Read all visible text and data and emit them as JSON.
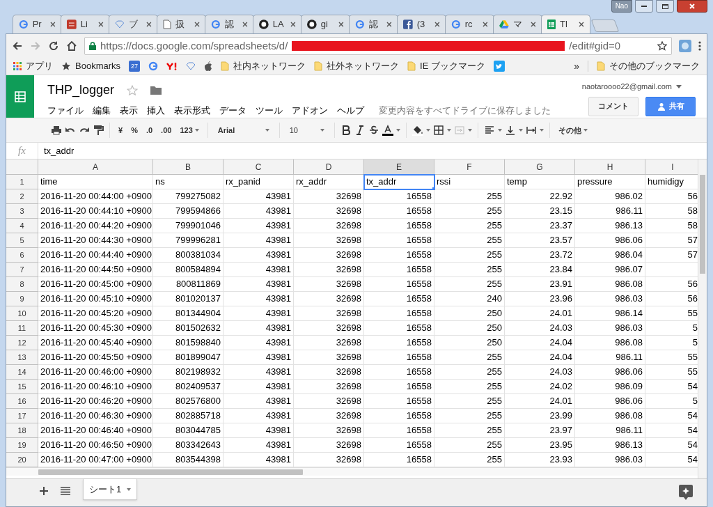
{
  "browser": {
    "profile": "Nao",
    "tabs": [
      {
        "label": "Pr",
        "kind": "google",
        "selected": false
      },
      {
        "label": "Li",
        "kind": "red",
        "selected": false
      },
      {
        "label": "ブ",
        "kind": "diamond",
        "selected": false
      },
      {
        "label": "扱",
        "kind": "page",
        "selected": false
      },
      {
        "label": "認",
        "kind": "google",
        "selected": false
      },
      {
        "label": "LA",
        "kind": "github",
        "selected": false
      },
      {
        "label": "gi",
        "kind": "github",
        "selected": false
      },
      {
        "label": "認",
        "kind": "google",
        "selected": false
      },
      {
        "label": "(3",
        "kind": "facebook",
        "selected": false
      },
      {
        "label": "rc",
        "kind": "google",
        "selected": false
      },
      {
        "label": "マ",
        "kind": "drive",
        "selected": false
      },
      {
        "label": "Tl",
        "kind": "sheets",
        "selected": true
      }
    ],
    "address": {
      "url_start": "https://docs.google.com/spreadsheets/d/",
      "url_end": "/edit#gid=0"
    },
    "bookmarks": [
      {
        "kind": "apps",
        "label": "アプリ"
      },
      {
        "kind": "star",
        "label": "Bookmarks"
      },
      {
        "kind": "calendar",
        "label": "27"
      },
      {
        "kind": "google"
      },
      {
        "kind": "yahoo"
      },
      {
        "kind": "diamond"
      },
      {
        "kind": "apple"
      },
      {
        "kind": "folder",
        "label": "社内ネットワーク"
      },
      {
        "kind": "folder",
        "label": "社外ネットワーク"
      },
      {
        "kind": "folder",
        "label": "IE ブックマーク"
      },
      {
        "kind": "twitter"
      }
    ],
    "more": "»",
    "other_bookmarks": "その他のブックマーク"
  },
  "sheets": {
    "title": "THP_logger",
    "account": "naotaroooo22@gmail.com",
    "menus": [
      "ファイル",
      "編集",
      "表示",
      "挿入",
      "表示形式",
      "データ",
      "ツール",
      "アドオン",
      "ヘルプ"
    ],
    "save_status": "変更内容をすべてドライブに保存しました",
    "comment_button": "コメント",
    "share_button": "共有",
    "toolbar": {
      "currency": "¥",
      "percent": "%",
      "decimal_less": ".0",
      "decimal_more": ".00",
      "format": "123",
      "font": "Arial",
      "size": "10",
      "more": "その他"
    },
    "formula_bar": {
      "label": "fx",
      "value": "tx_addr"
    },
    "columns": [
      {
        "label": "A",
        "kind": "text",
        "selected": false
      },
      {
        "label": "B",
        "kind": "number",
        "selected": false
      },
      {
        "label": "C",
        "kind": "number",
        "selected": false
      },
      {
        "label": "D",
        "kind": "number",
        "selected": false
      },
      {
        "label": "E",
        "kind": "number",
        "selected": true
      },
      {
        "label": "F",
        "kind": "number",
        "selected": false
      },
      {
        "label": "G",
        "kind": "number",
        "selected": false
      },
      {
        "label": "H",
        "kind": "number",
        "selected": false
      },
      {
        "label": "I",
        "kind": "number",
        "selected": false
      }
    ],
    "rows": [
      {
        "number": "1",
        "kind": "header",
        "active": true,
        "cells": [
          "time",
          "ns",
          "rx_panid",
          "rx_addr",
          "tx_addr",
          "rssi",
          "temp",
          "pressure",
          "humidigy"
        ]
      },
      {
        "number": "2",
        "kind": "data",
        "active": false,
        "cells": [
          "2016-11-20 00:44:00 +0900",
          "799275082",
          "43981",
          "32698",
          "16558",
          "255",
          "22.92",
          "986.02",
          "56"
        ]
      },
      {
        "number": "3",
        "kind": "data",
        "active": false,
        "cells": [
          "2016-11-20 00:44:10 +0900",
          "799594866",
          "43981",
          "32698",
          "16558",
          "255",
          "23.15",
          "986.11",
          "58"
        ]
      },
      {
        "number": "4",
        "kind": "data",
        "active": false,
        "cells": [
          "2016-11-20 00:44:20 +0900",
          "799901046",
          "43981",
          "32698",
          "16558",
          "255",
          "23.37",
          "986.13",
          "58"
        ]
      },
      {
        "number": "5",
        "kind": "data",
        "active": false,
        "cells": [
          "2016-11-20 00:44:30 +0900",
          "799996281",
          "43981",
          "32698",
          "16558",
          "255",
          "23.57",
          "986.06",
          "57"
        ]
      },
      {
        "number": "6",
        "kind": "data",
        "active": false,
        "cells": [
          "2016-11-20 00:44:40 +0900",
          "800381034",
          "43981",
          "32698",
          "16558",
          "255",
          "23.72",
          "986.04",
          "57"
        ]
      },
      {
        "number": "7",
        "kind": "data",
        "active": false,
        "cells": [
          "2016-11-20 00:44:50 +0900",
          "800584894",
          "43981",
          "32698",
          "16558",
          "255",
          "23.84",
          "986.07",
          null
        ]
      },
      {
        "number": "8",
        "kind": "data",
        "active": false,
        "cells": [
          "2016-11-20 00:45:00 +0900",
          "800811869",
          "43981",
          "32698",
          "16558",
          "255",
          "23.91",
          "986.08",
          "56"
        ]
      },
      {
        "number": "9",
        "kind": "data",
        "active": false,
        "cells": [
          "2016-11-20 00:45:10 +0900",
          "801020137",
          "43981",
          "32698",
          "16558",
          "240",
          "23.96",
          "986.03",
          "56"
        ]
      },
      {
        "number": "10",
        "kind": "data",
        "active": false,
        "cells": [
          "2016-11-20 00:45:20 +0900",
          "801344904",
          "43981",
          "32698",
          "16558",
          "250",
          "24.01",
          "986.14",
          "55"
        ]
      },
      {
        "number": "11",
        "kind": "data",
        "active": false,
        "cells": [
          "2016-11-20 00:45:30 +0900",
          "801502632",
          "43981",
          "32698",
          "16558",
          "250",
          "24.03",
          "986.03",
          "5"
        ]
      },
      {
        "number": "12",
        "kind": "data",
        "active": false,
        "cells": [
          "2016-11-20 00:45:40 +0900",
          "801598840",
          "43981",
          "32698",
          "16558",
          "250",
          "24.04",
          "986.08",
          "5"
        ]
      },
      {
        "number": "13",
        "kind": "data",
        "active": false,
        "cells": [
          "2016-11-20 00:45:50 +0900",
          "801899047",
          "43981",
          "32698",
          "16558",
          "255",
          "24.04",
          "986.11",
          "55"
        ]
      },
      {
        "number": "14",
        "kind": "data",
        "active": false,
        "cells": [
          "2016-11-20 00:46:00 +0900",
          "802198932",
          "43981",
          "32698",
          "16558",
          "255",
          "24.03",
          "986.06",
          "55"
        ]
      },
      {
        "number": "15",
        "kind": "data",
        "active": false,
        "cells": [
          "2016-11-20 00:46:10 +0900",
          "802409537",
          "43981",
          "32698",
          "16558",
          "255",
          "24.02",
          "986.09",
          "54"
        ]
      },
      {
        "number": "16",
        "kind": "data",
        "active": false,
        "cells": [
          "2016-11-20 00:46:20 +0900",
          "802576800",
          "43981",
          "32698",
          "16558",
          "255",
          "24.01",
          "986.06",
          "5"
        ]
      },
      {
        "number": "17",
        "kind": "data",
        "active": false,
        "cells": [
          "2016-11-20 00:46:30 +0900",
          "802885718",
          "43981",
          "32698",
          "16558",
          "255",
          "23.99",
          "986.08",
          "54"
        ]
      },
      {
        "number": "18",
        "kind": "data",
        "active": false,
        "cells": [
          "2016-11-20 00:46:40 +0900",
          "803044785",
          "43981",
          "32698",
          "16558",
          "255",
          "23.97",
          "986.11",
          "54"
        ]
      },
      {
        "number": "19",
        "kind": "data",
        "active": false,
        "cells": [
          "2016-11-20 00:46:50 +0900",
          "803342643",
          "43981",
          "32698",
          "16558",
          "255",
          "23.95",
          "986.13",
          "54"
        ]
      },
      {
        "number": "20",
        "kind": "data",
        "active": false,
        "cells": [
          "2016-11-20 00:47:00 +0900",
          "803544398",
          "43981",
          "32698",
          "16558",
          "255",
          "23.93",
          "986.03",
          "54"
        ]
      }
    ],
    "sheet_tabs": [
      {
        "label": "シート1",
        "selected": true
      }
    ]
  }
}
